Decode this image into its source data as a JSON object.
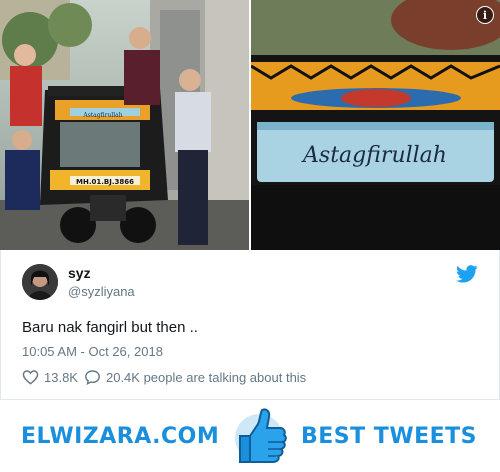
{
  "tweet": {
    "display_name": "syz",
    "handle": "@syzliyana",
    "text": "Baru nak fangirl but then ..",
    "timestamp": "10:05 AM - Oct 26, 2018",
    "likes": "13.8K",
    "talking": "20.4K people are talking about this"
  },
  "photos": {
    "plate": "Astagfirullah",
    "left_plate_small": "Astagfirullah",
    "registration": "MH.01.BJ.3866"
  },
  "banner": {
    "brand": "ELWIZARA.COM",
    "tagline": "BEST TWEETS"
  },
  "colors": {
    "accent": "#1da1f2",
    "banner_text": "#1a8fdd",
    "muted": "#657786"
  },
  "icons": {
    "info": "info-icon",
    "bird": "twitter-bird-icon",
    "heart": "heart-icon",
    "reply": "speech-bubble-icon",
    "thumbs": "thumbs-up-icon"
  }
}
